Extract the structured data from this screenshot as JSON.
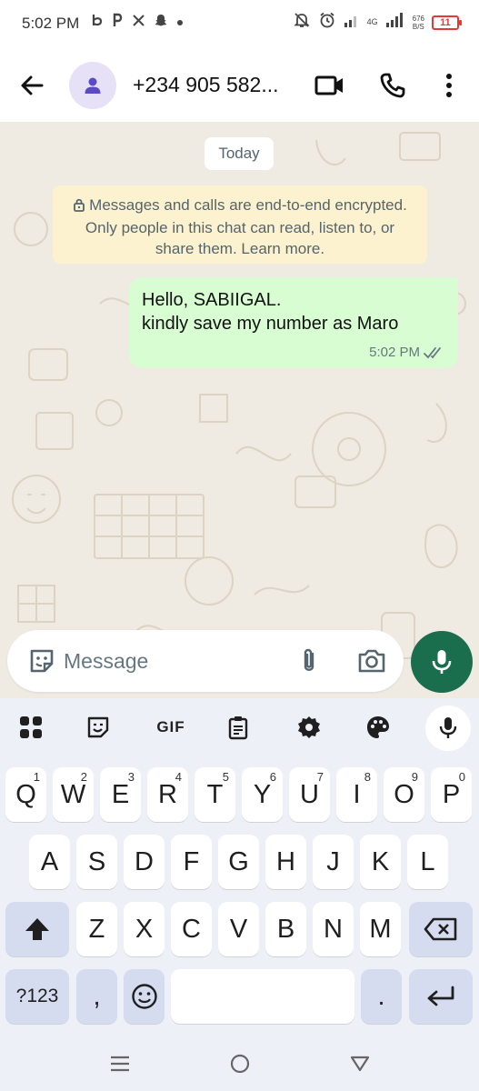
{
  "status_bar": {
    "time": "5:02 PM",
    "left_icons": [
      "b-icon",
      "p-icon",
      "x-icon",
      "snapchat-icon",
      "dot-icon"
    ],
    "network_label": "4G",
    "speed_value": "676",
    "speed_unit": "B/S",
    "battery_level": "11",
    "battery_color": "#e53935"
  },
  "header": {
    "contact_name": "+234 905 582..."
  },
  "chat": {
    "date_label": "Today",
    "encryption_notice": "Messages and calls are end-to-end encrypted. Only people in this chat can read, listen to, or share them. Learn more.",
    "messages": [
      {
        "direction": "outgoing",
        "line1": "Hello, SABIIGAL.",
        "line2": "kindly save my number as Maro",
        "time": "5:02 PM",
        "status": "delivered"
      }
    ]
  },
  "composer": {
    "placeholder": "Message"
  },
  "keyboard": {
    "toolbar": {
      "gif_label": "GIF"
    },
    "row1": [
      {
        "label": "Q",
        "hint": "1"
      },
      {
        "label": "W",
        "hint": "2"
      },
      {
        "label": "E",
        "hint": "3"
      },
      {
        "label": "R",
        "hint": "4"
      },
      {
        "label": "T",
        "hint": "5"
      },
      {
        "label": "Y",
        "hint": "6"
      },
      {
        "label": "U",
        "hint": "7"
      },
      {
        "label": "I",
        "hint": "8"
      },
      {
        "label": "O",
        "hint": "9"
      },
      {
        "label": "P",
        "hint": "0"
      }
    ],
    "row2": [
      "A",
      "S",
      "D",
      "F",
      "G",
      "H",
      "J",
      "K",
      "L"
    ],
    "row3": [
      "Z",
      "X",
      "C",
      "V",
      "B",
      "N",
      "M"
    ],
    "symbols_label": "?123",
    "comma_label": ",",
    "period_label": "."
  },
  "colors": {
    "accent": "#1b6e4d",
    "outgoing_bubble": "#d9fdd3",
    "notice_bg": "#fdf2cf",
    "chat_bg": "#efeae2",
    "tick": "#667781"
  }
}
